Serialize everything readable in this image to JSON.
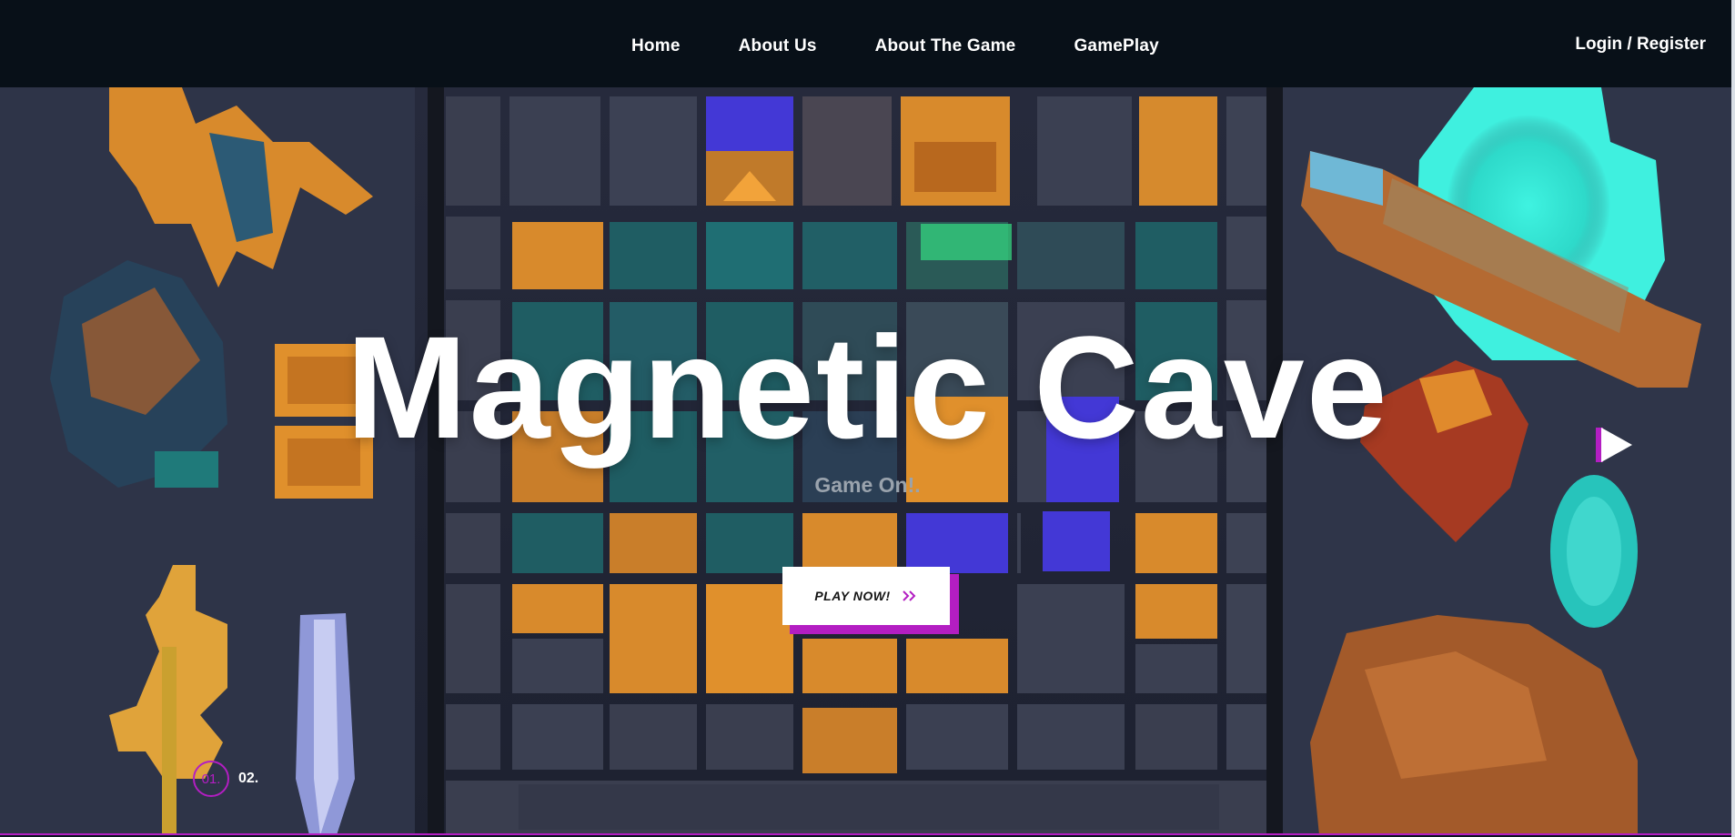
{
  "nav": {
    "items": [
      {
        "label": "Home"
      },
      {
        "label": "About Us"
      },
      {
        "label": "About The Game"
      },
      {
        "label": "GamePlay"
      }
    ],
    "login_label": "Login / Register"
  },
  "hero": {
    "title": "Magnetic Cave",
    "subtitle": "Game On!.",
    "play_button_label": "PLAY NOW!",
    "play_icon": "double-chevron-right-icon",
    "next_icon": "play-arrow-icon",
    "slides": {
      "current": "01.",
      "next": "02."
    }
  },
  "colors": {
    "header_bg": "#081018",
    "hero_bg": "#2b3146",
    "accent": "#b31ec2",
    "title": "#ffffff",
    "subtitle": "#9aa3ad",
    "tile_orange": "#e0902c",
    "tile_teal": "#1f6e73",
    "tile_blue": "#4338d6",
    "glow_cyan": "#2de6d3"
  }
}
